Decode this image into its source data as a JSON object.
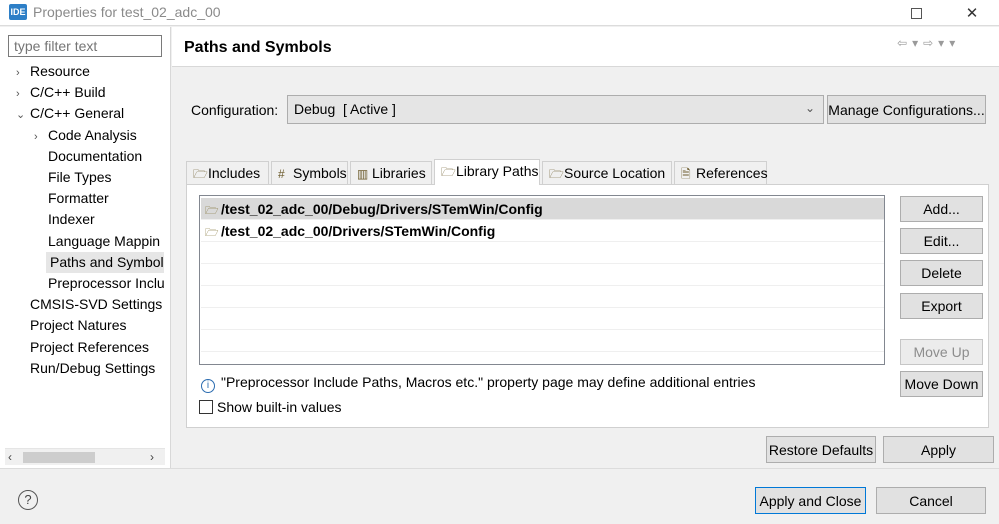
{
  "window": {
    "app_icon": "IDE",
    "title": "Properties for test_02_adc_00",
    "maximize_icon": "maximize-icon",
    "close_glyph": "✕"
  },
  "sidebar": {
    "filter_placeholder": "type filter text",
    "items": [
      {
        "label": "Resource",
        "arrow": "›",
        "level": 0
      },
      {
        "label": "C/C++ Build",
        "arrow": "›",
        "level": 0
      },
      {
        "label": "C/C++ General",
        "arrow": "⌄",
        "level": 0
      },
      {
        "label": "Code Analysis",
        "arrow": "›",
        "level": 1
      },
      {
        "label": "Documentation",
        "arrow": "",
        "level": 1
      },
      {
        "label": "File Types",
        "arrow": "",
        "level": 1
      },
      {
        "label": "Formatter",
        "arrow": "",
        "level": 1
      },
      {
        "label": "Indexer",
        "arrow": "",
        "level": 1
      },
      {
        "label": "Language Mappin",
        "arrow": "",
        "level": 1
      },
      {
        "label": "Paths and Symbols",
        "arrow": "",
        "level": 1,
        "selected": true
      },
      {
        "label": "Preprocessor Inclu",
        "arrow": "",
        "level": 1
      },
      {
        "label": "CMSIS-SVD Settings",
        "arrow": "",
        "level": 0
      },
      {
        "label": "Project Natures",
        "arrow": "",
        "level": 0
      },
      {
        "label": "Project References",
        "arrow": "",
        "level": 0
      },
      {
        "label": "Run/Debug Settings",
        "arrow": "",
        "level": 0
      }
    ],
    "scroll_left": "‹",
    "scroll_right": "›"
  },
  "page": {
    "title": "Paths and Symbols",
    "nav": {
      "back": "⇦",
      "back_menu": "▾",
      "forward": "⇨",
      "forward_menu": "▾",
      "view_menu": "▾"
    }
  },
  "configuration": {
    "label": "Configuration:",
    "selected": "Debug  [ Active ]",
    "manage_button": "Manage Configurations..."
  },
  "tabs": [
    {
      "label": "Includes",
      "icon": "🗁",
      "icon_name": "includes-folder-icon"
    },
    {
      "label": "Symbols",
      "icon": "#",
      "icon_name": "hash-icon"
    },
    {
      "label": "Libraries",
      "icon": "▥",
      "icon_name": "libraries-icon"
    },
    {
      "label": "Library Paths",
      "icon": "🗁",
      "icon_name": "library-paths-folder-icon",
      "active": true
    },
    {
      "label": "Source Location",
      "icon": "🗁",
      "icon_name": "source-folder-icon"
    },
    {
      "label": "References",
      "icon": "🗎",
      "icon_name": "references-icon"
    }
  ],
  "library_paths": [
    {
      "path": "/test_02_adc_00/Debug/Drivers/STemWin/Config",
      "selected": true
    },
    {
      "path": "/test_02_adc_00/Drivers/STemWin/Config",
      "selected": false
    }
  ],
  "side_buttons": {
    "add": "Add...",
    "edit": "Edit...",
    "delete": "Delete",
    "export": "Export",
    "move_up": "Move Up",
    "move_down": "Move Down"
  },
  "info_text": "\"Preprocessor Include Paths, Macros etc.\" property page may define additional entries",
  "show_builtin_label": "Show built-in values",
  "page_buttons": {
    "restore_defaults": "Restore Defaults",
    "apply": "Apply"
  },
  "dialog_buttons": {
    "help": "?",
    "apply_and_close": "Apply and Close",
    "cancel": "Cancel"
  }
}
